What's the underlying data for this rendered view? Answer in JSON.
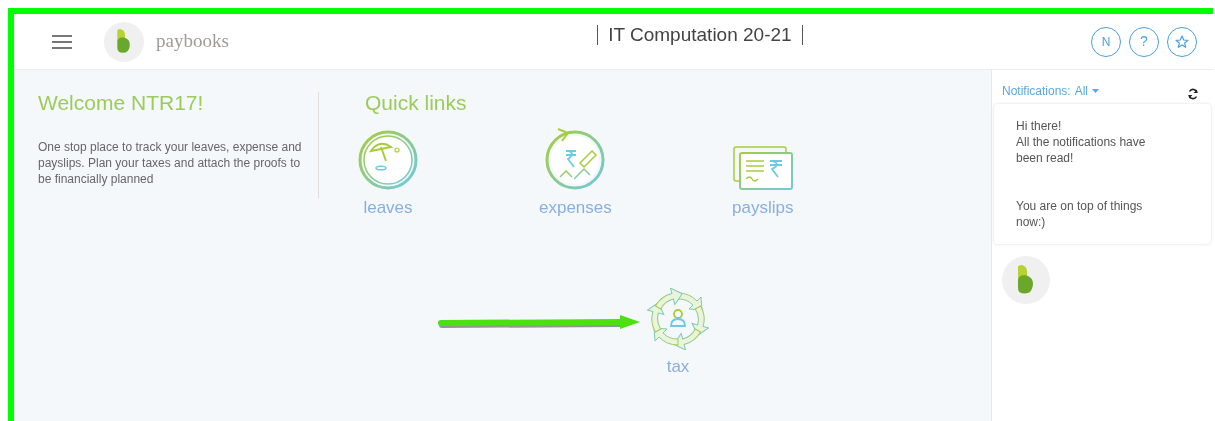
{
  "header": {
    "brand": "paybooks",
    "title": "IT Computation 20-21",
    "user_initial": "N",
    "help": "?"
  },
  "welcome": {
    "title": "Welcome NTR17!",
    "text": "One stop place to track your leaves, expense and payslips. Plan your taxes and attach the proofs to be financially planned"
  },
  "quick_links": {
    "title": "Quick links",
    "items": [
      {
        "label": "leaves",
        "kind": "leaves"
      },
      {
        "label": "expenses",
        "kind": "expenses"
      },
      {
        "label": "payslips",
        "kind": "payslips"
      }
    ],
    "featured": {
      "label": "tax",
      "kind": "tax"
    }
  },
  "notifications": {
    "label": "Notifications:",
    "filter": "All",
    "messages": [
      "Hi there!",
      "All the notifications have been read!",
      "You are on top of things now:)"
    ]
  }
}
